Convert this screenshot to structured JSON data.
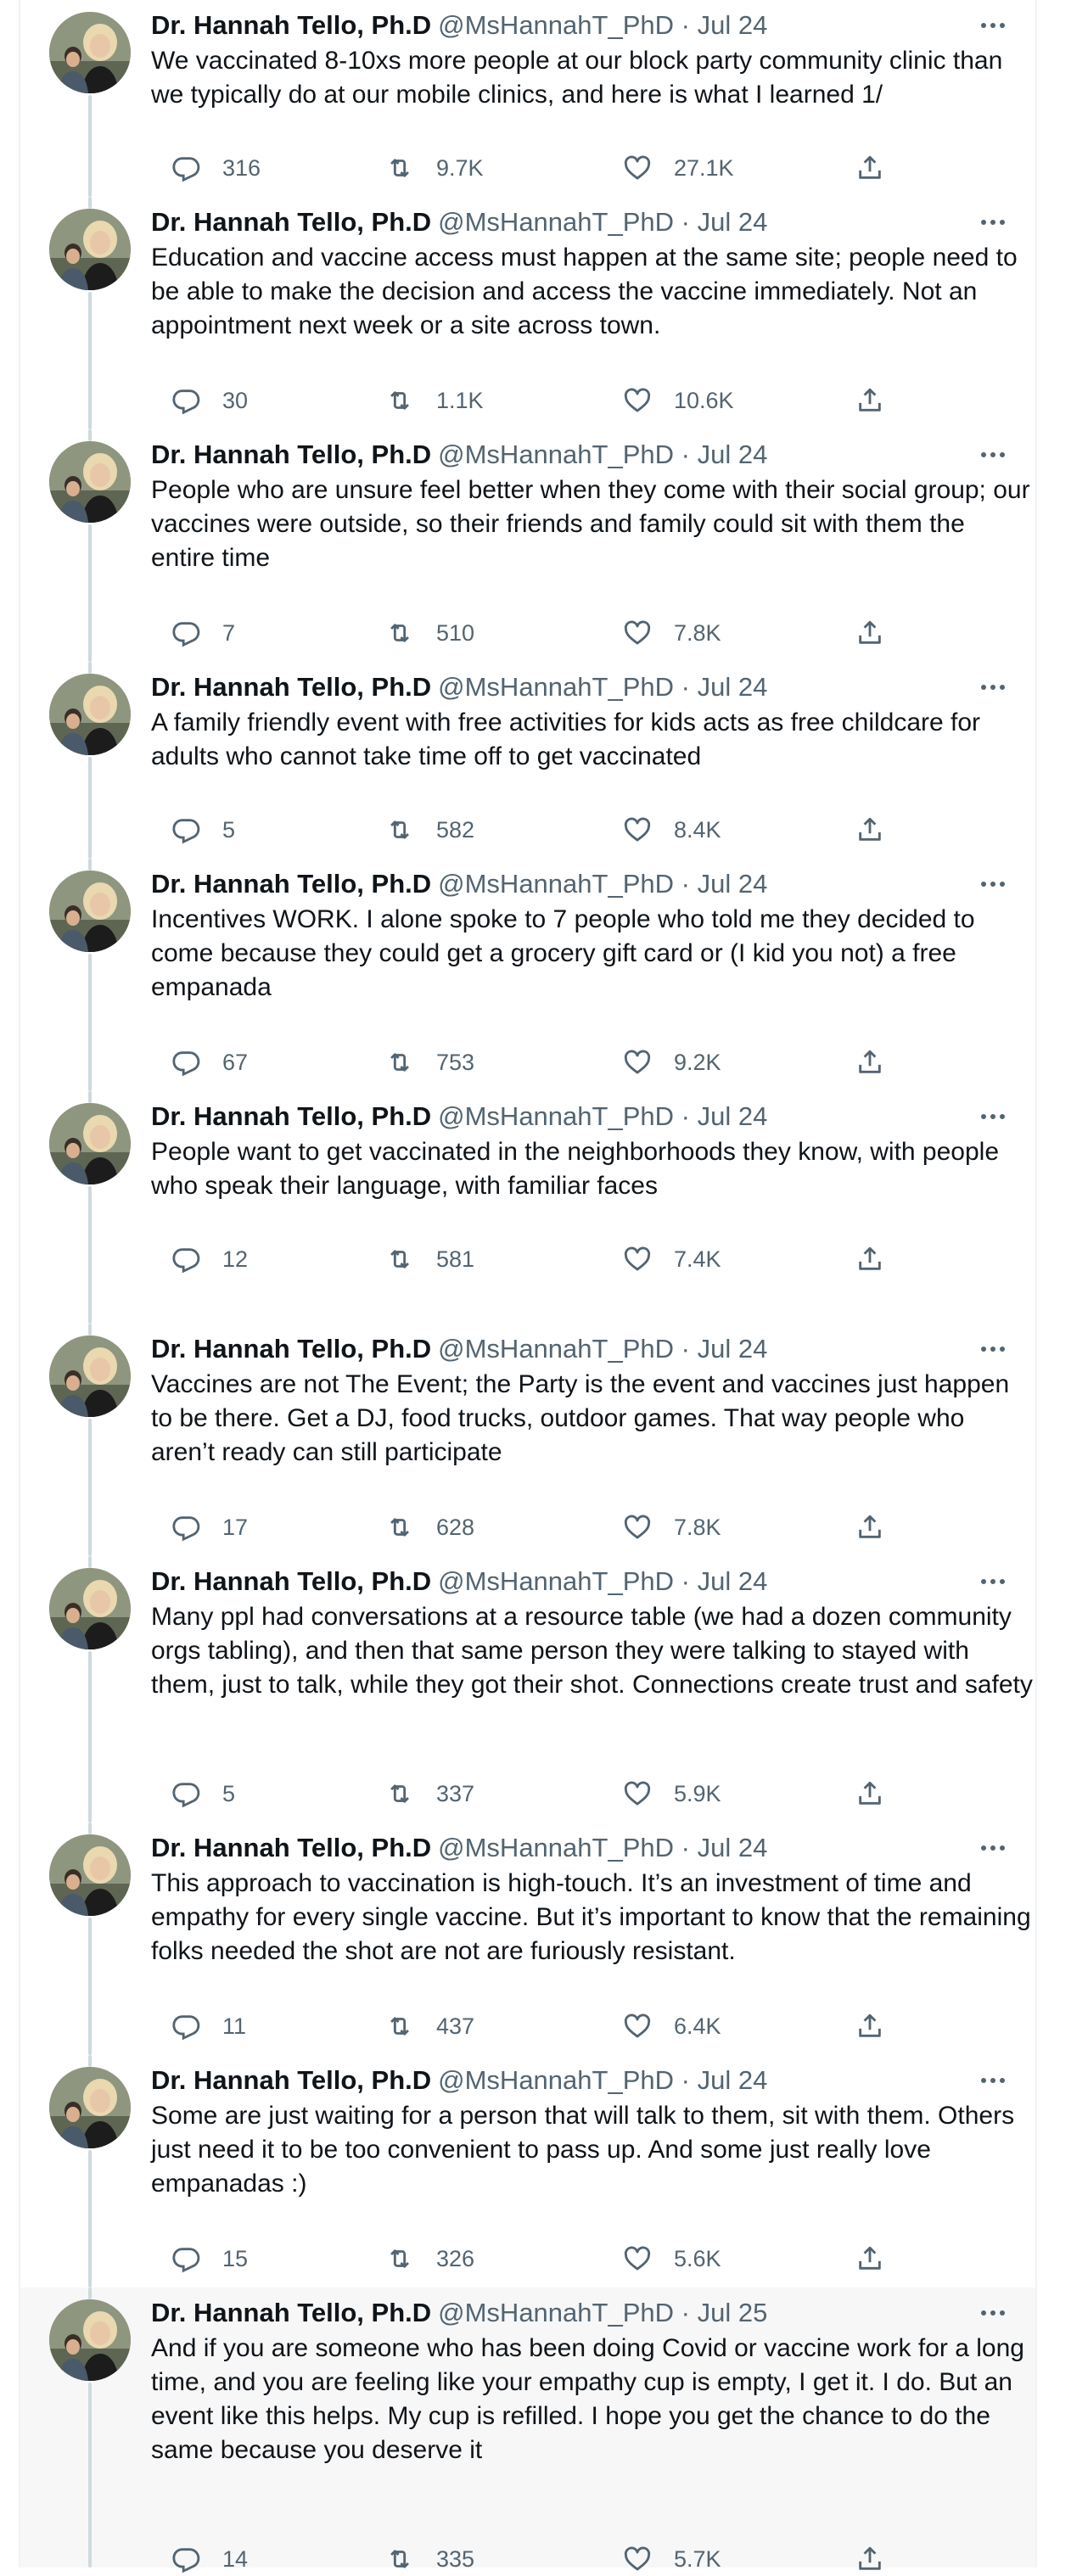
{
  "thread": {
    "tweets": [
      {
        "name": "Dr. Hannah Tello, Ph.D",
        "handle": "@MsHannahT_PhD",
        "sep": "·",
        "date": "Jul 24",
        "text": "We vaccinated 8-10xs more people at our block party community clinic than we typically do at our mobile clinics, and here is what I learned 1/",
        "replies": "316",
        "retweets": "9.7K",
        "likes": "27.1K"
      },
      {
        "name": "Dr. Hannah Tello, Ph.D",
        "handle": "@MsHannahT_PhD",
        "sep": "·",
        "date": "Jul 24",
        "text": "Education and vaccine access must happen at the same site; people need to be able to make the decision and access the vaccine immediately. Not an appointment next week or a site across town.",
        "replies": "30",
        "retweets": "1.1K",
        "likes": "10.6K"
      },
      {
        "name": "Dr. Hannah Tello, Ph.D",
        "handle": "@MsHannahT_PhD",
        "sep": "·",
        "date": "Jul 24",
        "text": "People who are unsure feel better when they come with their social group; our vaccines were outside, so their friends and family could sit with them the entire time",
        "replies": "7",
        "retweets": "510",
        "likes": "7.8K"
      },
      {
        "name": "Dr. Hannah Tello, Ph.D",
        "handle": "@MsHannahT_PhD",
        "sep": "·",
        "date": "Jul 24",
        "text": "A family friendly event with free activities for kids acts as free childcare for adults who cannot take time off to get vaccinated",
        "replies": "5",
        "retweets": "582",
        "likes": "8.4K"
      },
      {
        "name": "Dr. Hannah Tello, Ph.D",
        "handle": "@MsHannahT_PhD",
        "sep": "·",
        "date": "Jul 24",
        "text": "Incentives WORK. I alone spoke to 7 people who told me they decided to come because they could get a grocery gift card or (I kid you not) a free empanada",
        "replies": "67",
        "retweets": "753",
        "likes": "9.2K"
      },
      {
        "name": "Dr. Hannah Tello, Ph.D",
        "handle": "@MsHannahT_PhD",
        "sep": "·",
        "date": "Jul 24",
        "text": "People want to get vaccinated in the neighborhoods they know, with people who speak their language, with familiar faces",
        "replies": "12",
        "retweets": "581",
        "likes": "7.4K"
      },
      {
        "name": "Dr. Hannah Tello, Ph.D",
        "handle": "@MsHannahT_PhD",
        "sep": "·",
        "date": "Jul 24",
        "text": "Vaccines are not The Event; the Party is the event and vaccines just happen to be there. Get a DJ, food trucks, outdoor games. That way people who aren’t ready can still participate",
        "replies": "17",
        "retweets": "628",
        "likes": "7.8K"
      },
      {
        "name": "Dr. Hannah Tello, Ph.D",
        "handle": "@MsHannahT_PhD",
        "sep": "·",
        "date": "Jul 24",
        "text": "Many ppl had conversations at a resource table (we had a dozen community orgs tabling), and then that same person they were talking to stayed with them, just to talk, while they got their shot. Connections create trust and safety",
        "replies": "5",
        "retweets": "337",
        "likes": "5.9K"
      },
      {
        "name": "Dr. Hannah Tello, Ph.D",
        "handle": "@MsHannahT_PhD",
        "sep": "·",
        "date": "Jul 24",
        "text": "This approach to vaccination is high-touch. It’s an investment of time and empathy for every single vaccine. But it’s important to know that the remaining folks needed the shot are not are furiously resistant.",
        "replies": "11",
        "retweets": "437",
        "likes": "6.4K"
      },
      {
        "name": "Dr. Hannah Tello, Ph.D",
        "handle": "@MsHannahT_PhD",
        "sep": "·",
        "date": "Jul 24",
        "text": "Some are just waiting for a person that will talk to them, sit with them. Others just need it to be too convenient to pass up. And some just really love empanadas :)",
        "replies": "15",
        "retweets": "326",
        "likes": "5.6K"
      },
      {
        "name": "Dr. Hannah Tello, Ph.D",
        "handle": "@MsHannahT_PhD",
        "sep": "·",
        "date": "Jul 25",
        "text": "And if you are someone who has been doing Covid or vaccine work for a long time, and you are feeling like your empathy cup is empty, I get it. I do. But an event like this helps. My cup is refilled. I hope you get the chance to do the same because you deserve it",
        "replies": "14",
        "retweets": "335",
        "likes": "5.7K"
      }
    ]
  },
  "icons": {
    "reply": "reply-icon",
    "retweet": "retweet-icon",
    "like": "heart-icon",
    "share": "share-icon",
    "more": "more-icon"
  },
  "colors": {
    "text": "#0f1419",
    "secondary": "#536471",
    "thread_line": "#cfd9de",
    "highlight_bg": "#f7f7f7"
  }
}
